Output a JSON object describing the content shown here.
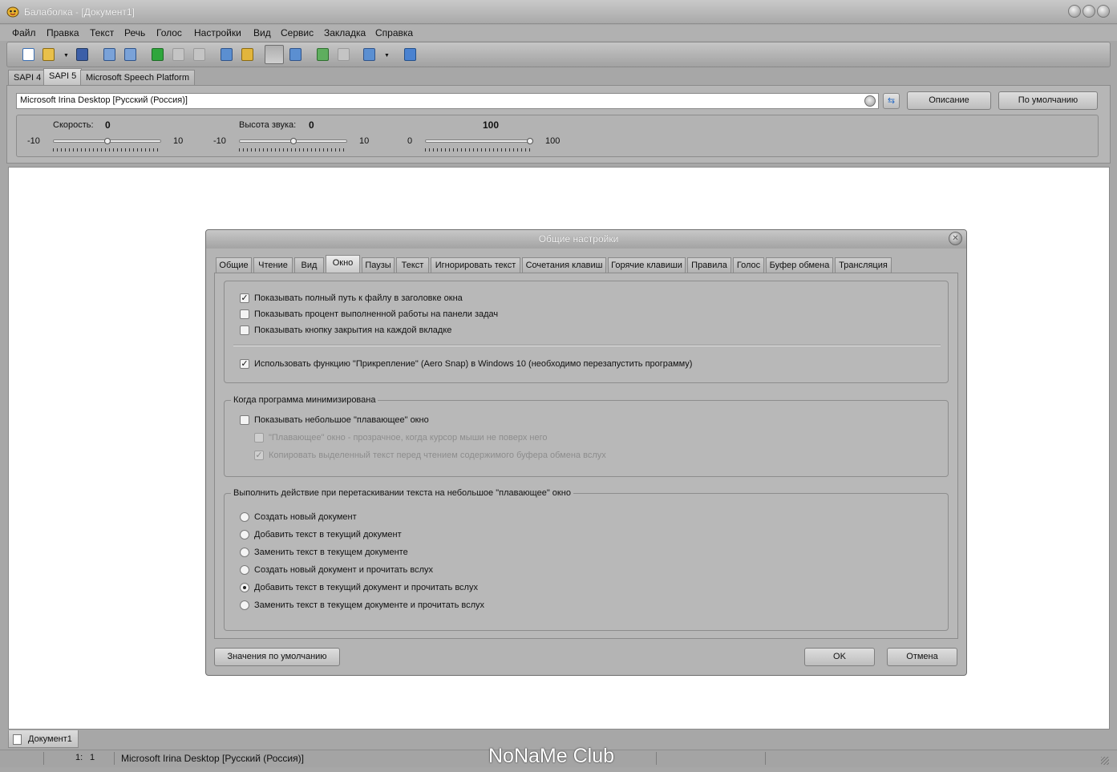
{
  "window": {
    "title": "Балаболка - [Документ1]"
  },
  "menu": [
    "Файл",
    "Правка",
    "Текст",
    "Речь",
    "Голос",
    "Настройки",
    "Вид",
    "Сервис",
    "Закладка",
    "Справка"
  ],
  "engine_tabs": [
    "SAPI 4",
    "SAPI 5",
    "Microsoft Speech Platform"
  ],
  "voice": {
    "selected": "Microsoft Irina Desktop [Русский (Россия)]",
    "description_button": "Описание",
    "default_button": "По умолчанию"
  },
  "params": {
    "rate": {
      "label": "Скорость:",
      "value": "0",
      "min": "-10",
      "max": "10",
      "level": 0
    },
    "pitch": {
      "label": "Высота звука:",
      "value": "0",
      "min": "-10",
      "max": "10",
      "level": 0
    },
    "volume": {
      "value": "100",
      "min": "0",
      "max": "100",
      "level": 100
    }
  },
  "document_tab": "Документ1",
  "status": {
    "pos_line": "1:",
    "pos_col": "1",
    "voice": "Microsoft Irina Desktop [Русский (Россия)]"
  },
  "watermark": "NoNaMe Club",
  "dialog": {
    "title": "Общие настройки",
    "tabs": [
      "Общие",
      "Чтение",
      "Вид",
      "Окно",
      "Паузы",
      "Текст",
      "Игнорировать текст",
      "Сочетания клавиш",
      "Горячие клавиши",
      "Правила",
      "Голос",
      "Буфер обмена",
      "Трансляция"
    ],
    "active_tab": "Окно",
    "window_options": [
      {
        "label": "Показывать полный путь к файлу в заголовке окна",
        "checked": true
      },
      {
        "label": "Показывать процент выполненной работы на панели задач",
        "checked": false
      },
      {
        "label": "Показывать кнопку закрытия на каждой вкладке",
        "checked": false
      }
    ],
    "aero_snap": {
      "label": "Использовать функцию \"Прикрепление\" (Aero Snap) в Windows 10 (необходимо перезапустить программу)",
      "checked": true
    },
    "minimized_group": {
      "title": "Когда программа минимизирована",
      "show_floating": {
        "label": "Показывать небольшое \"плавающее\" окно",
        "checked": false
      },
      "transparent": {
        "label": "\"Плавающее\" окно - прозрачное, когда курсор мыши не поверх него",
        "checked": false
      },
      "copy_selected": {
        "label": "Копировать выделенный текст перед чтением содержимого буфера обмена вслух",
        "checked": true
      }
    },
    "drag_group": {
      "title": "Выполнить действие при перетаскивании текста на небольшое \"плавающее\" окно",
      "options": [
        "Создать новый документ",
        "Добавить текст в текущий документ",
        "Заменить текст в текущем документе",
        "Создать новый документ и прочитать вслух",
        "Добавить текст в текущий документ и прочитать вслух",
        "Заменить текст в текущем документе и прочитать вслух"
      ],
      "selected_index": 4
    },
    "defaults_button": "Значения по умолчанию",
    "ok_button": "OK",
    "cancel_button": "Отмена"
  },
  "colors": {
    "chrome": "#a7a7a7",
    "document": "#ffffff",
    "accent_blue": "#2a6cc4"
  }
}
